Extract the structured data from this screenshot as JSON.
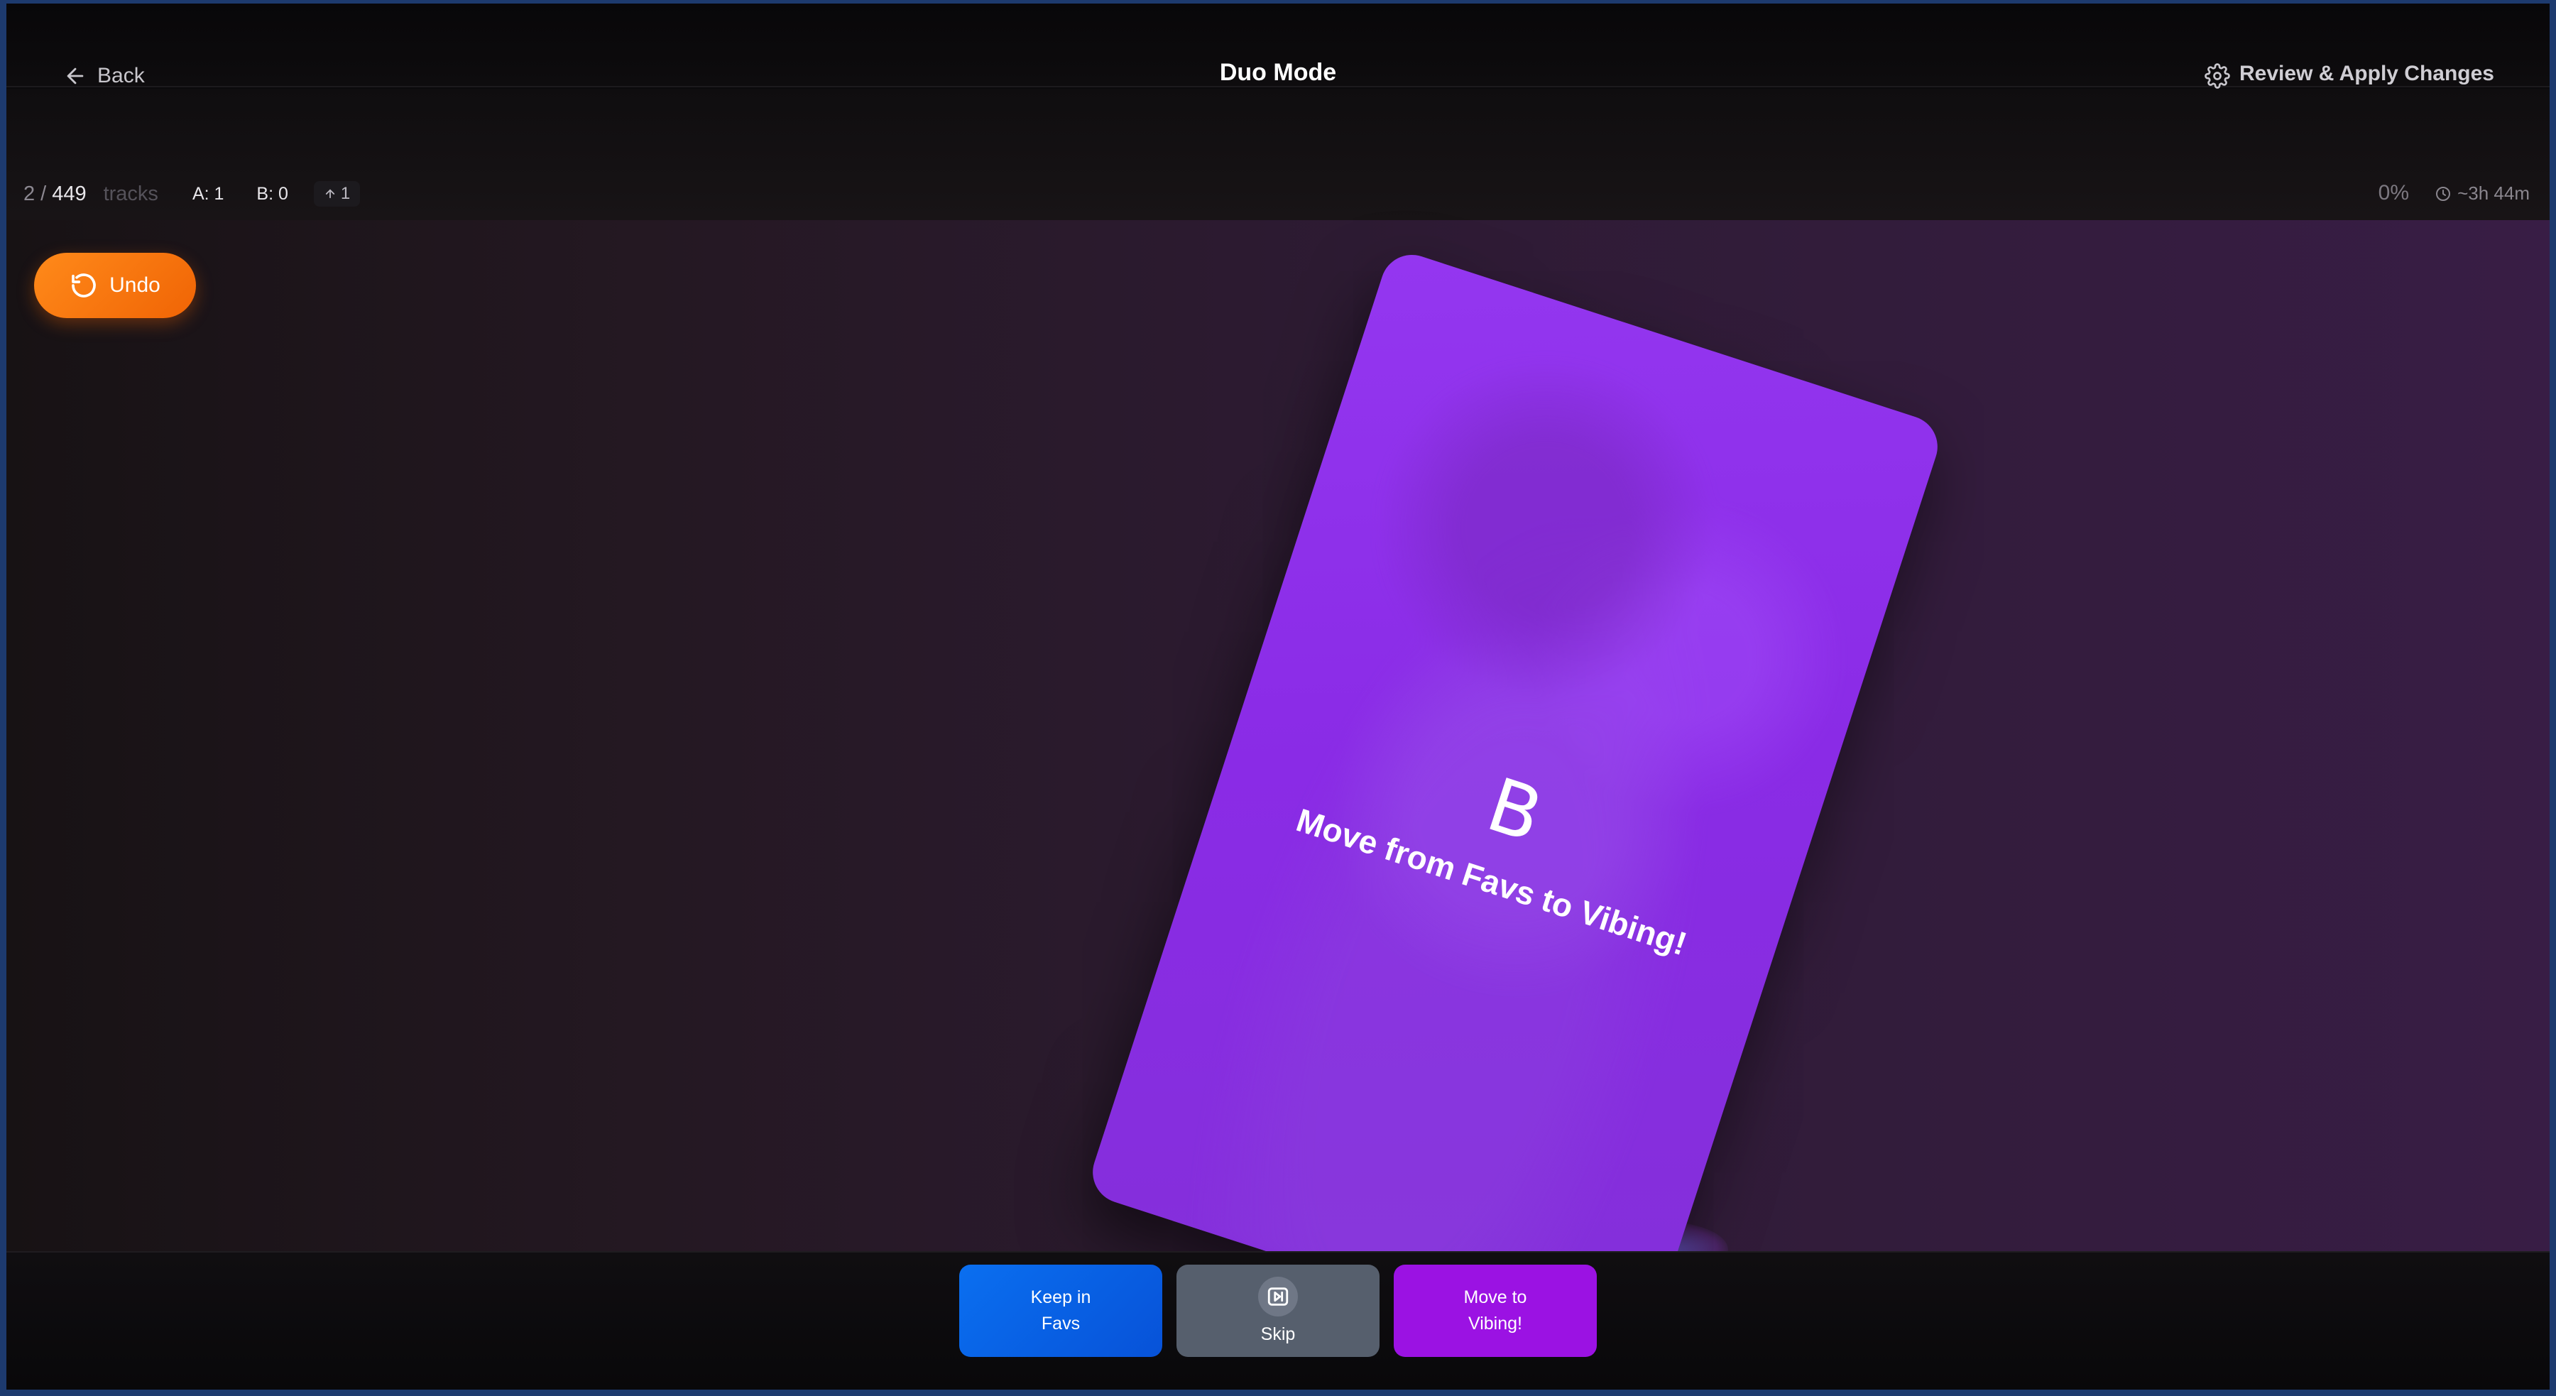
{
  "header": {
    "back_label": "Back",
    "title": "Duo Mode",
    "settings_icon": "gear-icon",
    "review_label": "Review & Apply Changes"
  },
  "stats": {
    "current": "2",
    "separator": "/",
    "total": "449",
    "unit": "tracks",
    "a_count": "A: 1",
    "b_count": "B: 0",
    "up_count": "1",
    "progress": "0%",
    "eta": "~3h 44m"
  },
  "undo": {
    "label": "Undo",
    "icon": "undo-icon"
  },
  "card": {
    "letter": "B",
    "label": "Move from Favs to Vibing!"
  },
  "actions": {
    "keep": {
      "line1": "Keep in",
      "line2": "Favs",
      "color": "#0a6ff0"
    },
    "skip": {
      "label": "Skip",
      "icon": "skip-icon",
      "color": "#565f6d"
    },
    "move": {
      "line1": "Move to",
      "line2": "Vibing!",
      "color": "#9b12e3"
    }
  },
  "colors": {
    "accent_orange": "#f06405",
    "card_purple": "#8a2be6"
  }
}
